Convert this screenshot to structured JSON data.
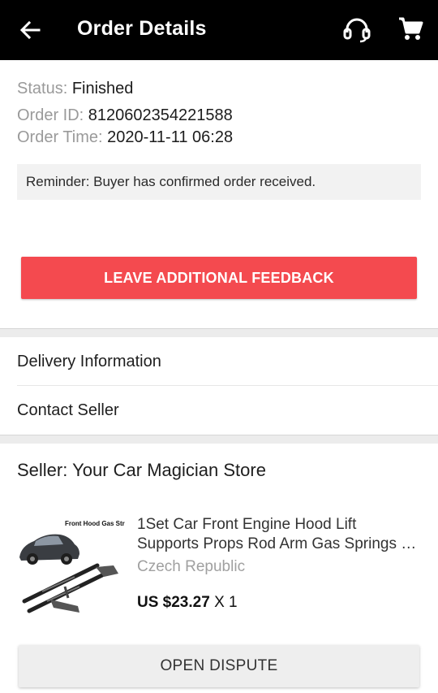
{
  "header": {
    "title": "Order Details",
    "back_icon": "arrow-left-icon",
    "support_icon": "headset-icon",
    "cart_icon": "cart-icon"
  },
  "order": {
    "status_label": "Status: ",
    "status_value": "Finished",
    "id_label": "Order ID: ",
    "id_value": "8120602354221588",
    "time_label": "Order Time: ",
    "time_value": "2020-11-11 06:28",
    "reminder": "Reminder: Buyer has confirmed order received."
  },
  "actions": {
    "feedback_label": "LEAVE ADDITIONAL FEEDBACK",
    "dispute_label": "OPEN DISPUTE"
  },
  "links": {
    "delivery": "Delivery Information",
    "contact": "Contact Seller"
  },
  "seller": {
    "label": "Seller: Your Car Magician Store"
  },
  "product": {
    "title_line1": "1Set Car Front Engine Hood Lift",
    "title_line2": "Supports Props Rod Arm Gas Springs Shock",
    "location": "Czech Republic",
    "price": "US $23.27",
    "quantity": " X 1",
    "image_caption": "Front Hood Gas Struts"
  },
  "colors": {
    "topbar": "#000000",
    "accent": "#f44a4f"
  }
}
